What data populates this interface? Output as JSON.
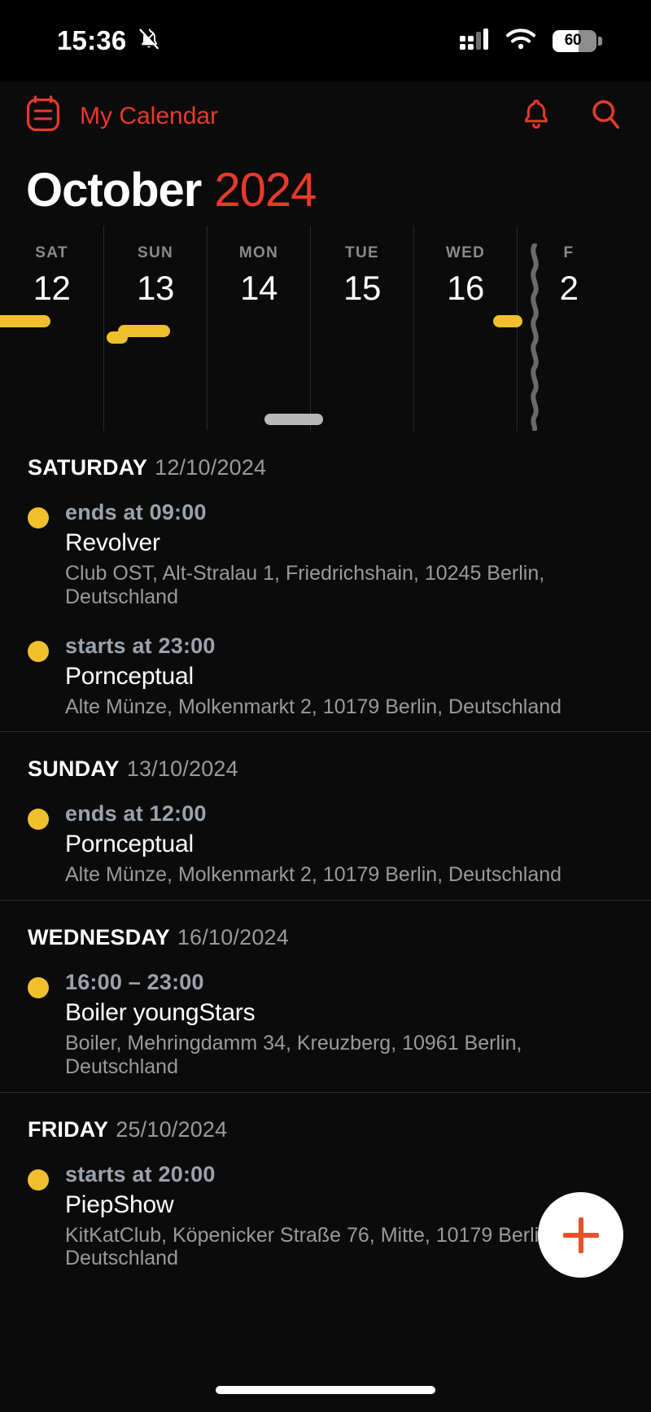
{
  "status_bar": {
    "time": "15:36",
    "mute_icon": "bell-slash-icon",
    "signal_icon": "cellular-signal-icon",
    "wifi_icon": "wifi-icon",
    "battery_percent": "60",
    "battery_level": 60
  },
  "app_bar": {
    "menu_icon": "calendar-list-icon",
    "title": "My Calendar",
    "notifications_icon": "bell-icon",
    "search_icon": "search-icon",
    "accent_color": "#e8392b"
  },
  "header": {
    "month": "October",
    "year": "2024"
  },
  "day_strip": {
    "scroll_indicator": "horizontal-scroll-thumb",
    "gap_indicator": "wavy-time-gap-line",
    "days": [
      {
        "dow": "SAT",
        "num": "12"
      },
      {
        "dow": "SUN",
        "num": "13"
      },
      {
        "dow": "MON",
        "num": "14"
      },
      {
        "dow": "TUE",
        "num": "15"
      },
      {
        "dow": "WED",
        "num": "16"
      },
      {
        "dow": "F",
        "num": "2"
      }
    ]
  },
  "sections": [
    {
      "day_name": "SATURDAY",
      "date": "12/10/2024",
      "events": [
        {
          "time": "ends at 09:00",
          "title": "Revolver",
          "location": "Club OST, Alt-Stralau 1, Friedrichshain, 10245 Berlin, Deutschland",
          "dot_color": "#f0c02c"
        },
        {
          "time": "starts at 23:00",
          "title": "Pornceptual",
          "location": "Alte Münze, Molkenmarkt 2, 10179 Berlin, Deutschland",
          "dot_color": "#f0c02c"
        }
      ]
    },
    {
      "day_name": "SUNDAY",
      "date": "13/10/2024",
      "events": [
        {
          "time": "ends at 12:00",
          "title": "Pornceptual",
          "location": "Alte Münze, Molkenmarkt 2, 10179 Berlin, Deutschland",
          "dot_color": "#f0c02c"
        }
      ]
    },
    {
      "day_name": "WEDNESDAY",
      "date": "16/10/2024",
      "events": [
        {
          "time": "16:00 – 23:00",
          "title": "Boiler youngStars",
          "location": "Boiler, Mehringdamm 34, Kreuzberg, 10961 Berlin, Deutschland",
          "dot_color": "#f0c02c"
        }
      ]
    },
    {
      "day_name": "FRIDAY",
      "date": "25/10/2024",
      "events": [
        {
          "time": "starts at 20:00",
          "title": "PiepShow",
          "location": "KitKatClub, Köpenicker Straße 76, Mitte, 10179 Berlin, Deutschland",
          "dot_color": "#f0c02c"
        }
      ]
    }
  ],
  "fab": {
    "icon": "plus-icon",
    "label": "+"
  },
  "home_indicator": "home-indicator"
}
